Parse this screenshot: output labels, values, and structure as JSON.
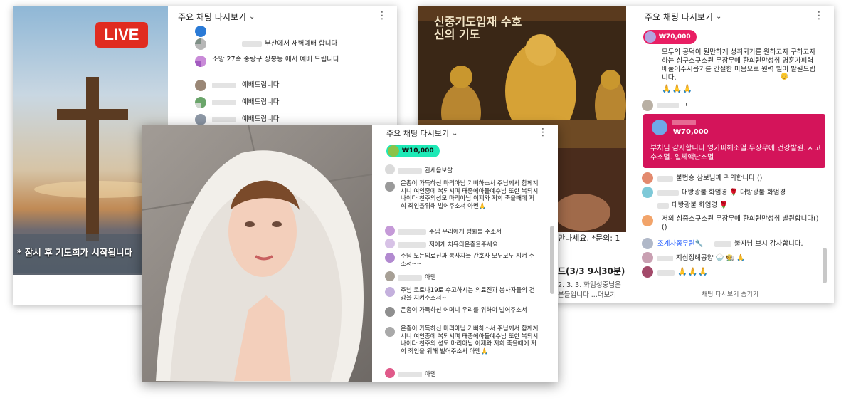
{
  "left_card": {
    "live_badge": "LIVE",
    "caption": "* 잠시 후 기도회가 시작됩니다",
    "chat": {
      "title": "주요 채팅 다시보기",
      "messages": [
        {
          "text": "부산에서 새벽예배 합니다"
        },
        {
          "text": "소망 27속 중랑구 상봉동 에서 예배 드립니다"
        },
        {
          "text": "예배드립니다"
        },
        {
          "text": "예배드립니다"
        },
        {
          "text": "예배드립니다"
        }
      ]
    }
  },
  "right_card": {
    "video_title": "신중기도입재 수호신의 기도",
    "subtitle_fragment": "만나세요. *문의: 1",
    "bottom_texts": [
      "드(3/3 9시30분)",
      "2. 3. 3. 화엄성중님은",
      "분들입니다 ...더보기"
    ],
    "chat": {
      "title": "주요 채팅 다시보기",
      "top_donation": "₩70,000",
      "pinned_text": "모두의 공덕이 원만하게 성취되기를 원하고자 구하고자 하는 심구소구소원 무장무애 환희원만성취 명훈가피력 베풀어주시옵기를 간절한 마음으로 원력 빌어 발원드립니다.",
      "pinned_emoji": "👴",
      "pinned_pray": "🙏🙏🙏",
      "short_msg": "ㄱ",
      "superchat_amount": "₩70,000",
      "superchat_text": "부처님 감사합니다 영가피해소멸.무장무애.건강발원. 사고수소멸. 일체액난소멸",
      "messages": [
        {
          "text": "불법승 삼보님께 귀의합니다 ()"
        },
        {
          "text": "대방광불 화엄경 🌹 대방광불 화엄경"
        },
        {
          "text": "대방광불 화엄경 🌹"
        },
        {
          "text": "저의 심중소구소원 무장무애 환희원만성취 발원합니다()()"
        },
        {
          "text": "불자님 보시 감사합니다."
        },
        {
          "text": "지심정례공양 🍚 🧑‍🌾 🙏"
        },
        {
          "text": "🙏🙏🙏"
        }
      ],
      "moderator_name": "조계사종무원🔧",
      "footer": "채팅 다시보기 숨기기"
    }
  },
  "front_card": {
    "chat": {
      "title": "주요 채팅 다시보기",
      "donation": "₩10,000",
      "messages": [
        {
          "text": "관세음보살"
        },
        {
          "text": "은총이 가득하신 마리아님 기뻐하소서 주님께서 함께계시니 여인중에 복되시며 태중에아들예수님 또한 복되시나이다 천주의성모 마리아님 이제와 저희 죽을때에 저희 죄인을위해 빌어주소서 아멘🙏"
        },
        {
          "text": "주님 우리에게 평화를 주소서"
        },
        {
          "text": "저에게 치유의은총을주세요"
        },
        {
          "text": "주님 모든의료진과 봉사자들 간호사 모두모두 지켜 주소서~~"
        },
        {
          "text": "아멘"
        },
        {
          "text": "주님 코로나19로 수고하시는 의료진과 봉사자들의 건강을 지켜주소서~"
        },
        {
          "text": "은총이 가득하신 어머니 우리를 위하여 빌어주소서"
        },
        {
          "text": "은총이 가득하신 마리아님 기뻐하소서 주님께서 함께계시니 여인중에 복되시며 태중에아들예수님 또한 복되시나이다 천주의 성모 마리아님 이제와 저희 죽을때에 저희 죄인을 위해 빌어주소서 아멘🙏"
        },
        {
          "text": "아멘"
        }
      ]
    }
  },
  "colors": {
    "superchat": "#d4145a",
    "donation_pink": "#e91e63",
    "donation_green": "#1de9b6",
    "live_red": "#e02b20"
  }
}
